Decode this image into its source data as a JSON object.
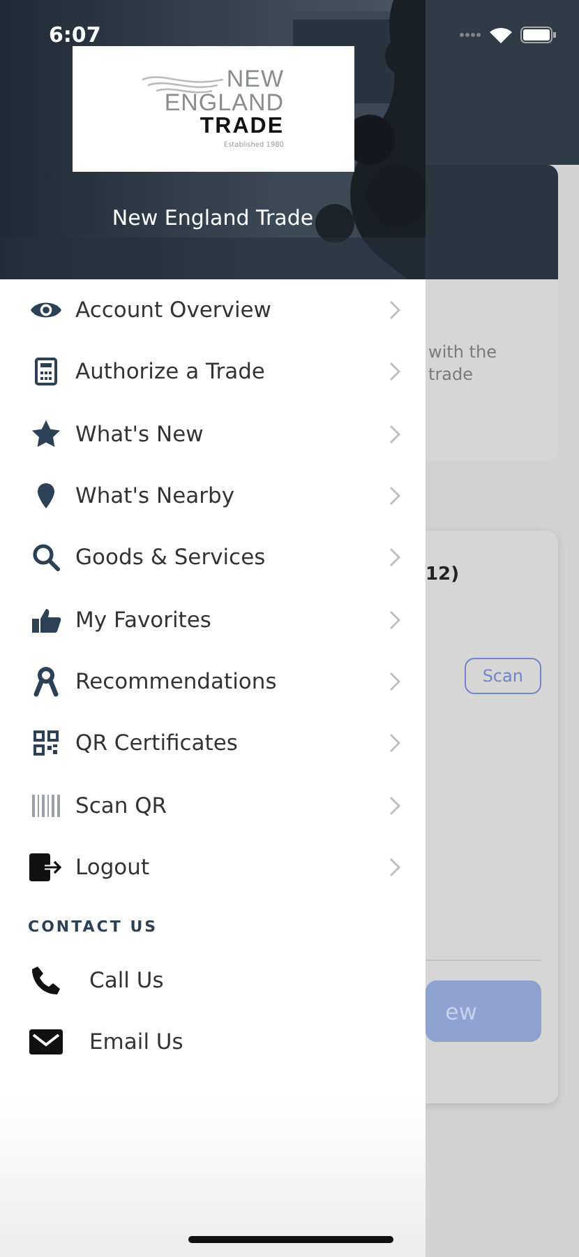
{
  "status_bar": {
    "time": "6:07"
  },
  "drawer": {
    "logo": {
      "line_1": "NEW",
      "line_2": "ENGLAND",
      "line_3": "TRADE",
      "tagline": "Established 1980"
    },
    "title": "New England Trade",
    "menu_items": [
      {
        "label": "Account Overview"
      },
      {
        "label": "Authorize a Trade"
      },
      {
        "label": "What's New"
      },
      {
        "label": "What's Nearby"
      },
      {
        "label": "Goods & Services"
      },
      {
        "label": "My Favorites"
      },
      {
        "label": "Recommendations"
      },
      {
        "label": "QR Certificates"
      },
      {
        "label": "Scan QR"
      },
      {
        "label": "Logout"
      }
    ],
    "contact_heading": "CONTACT US",
    "contact_items": [
      {
        "label": "Call Us"
      },
      {
        "label": "Email Us"
      }
    ]
  },
  "background_page": {
    "card_1_text": [
      "with the",
      "trade"
    ],
    "card_2_title": "12)",
    "scan_button": "Scan",
    "action_button": "ew"
  }
}
